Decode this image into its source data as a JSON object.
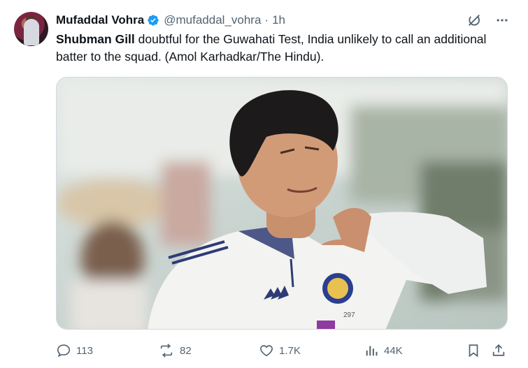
{
  "author": {
    "name": "Mufaddal Vohra",
    "handle": "@mufaddal_vohra",
    "time": "1h"
  },
  "separator": "·",
  "tweet": {
    "bold": "Shubman Gill",
    "text": " doubtful for the Guwahati Test, India unlikely to call an additional batter to the squad. (Amol Karhadkar/The Hindu)."
  },
  "image": {
    "jersey_number": "297"
  },
  "stats": {
    "replies": "113",
    "reposts": "82",
    "likes": "1.7K",
    "views": "44K"
  },
  "icons": [
    "grok-icon",
    "more-icon",
    "reply-icon",
    "repost-icon",
    "like-icon",
    "views-icon",
    "bookmark-icon",
    "share-icon",
    "verified-badge-icon"
  ],
  "colors": {
    "verified": "#1d9bf0",
    "muted": "#536471",
    "text": "#0f1419"
  }
}
